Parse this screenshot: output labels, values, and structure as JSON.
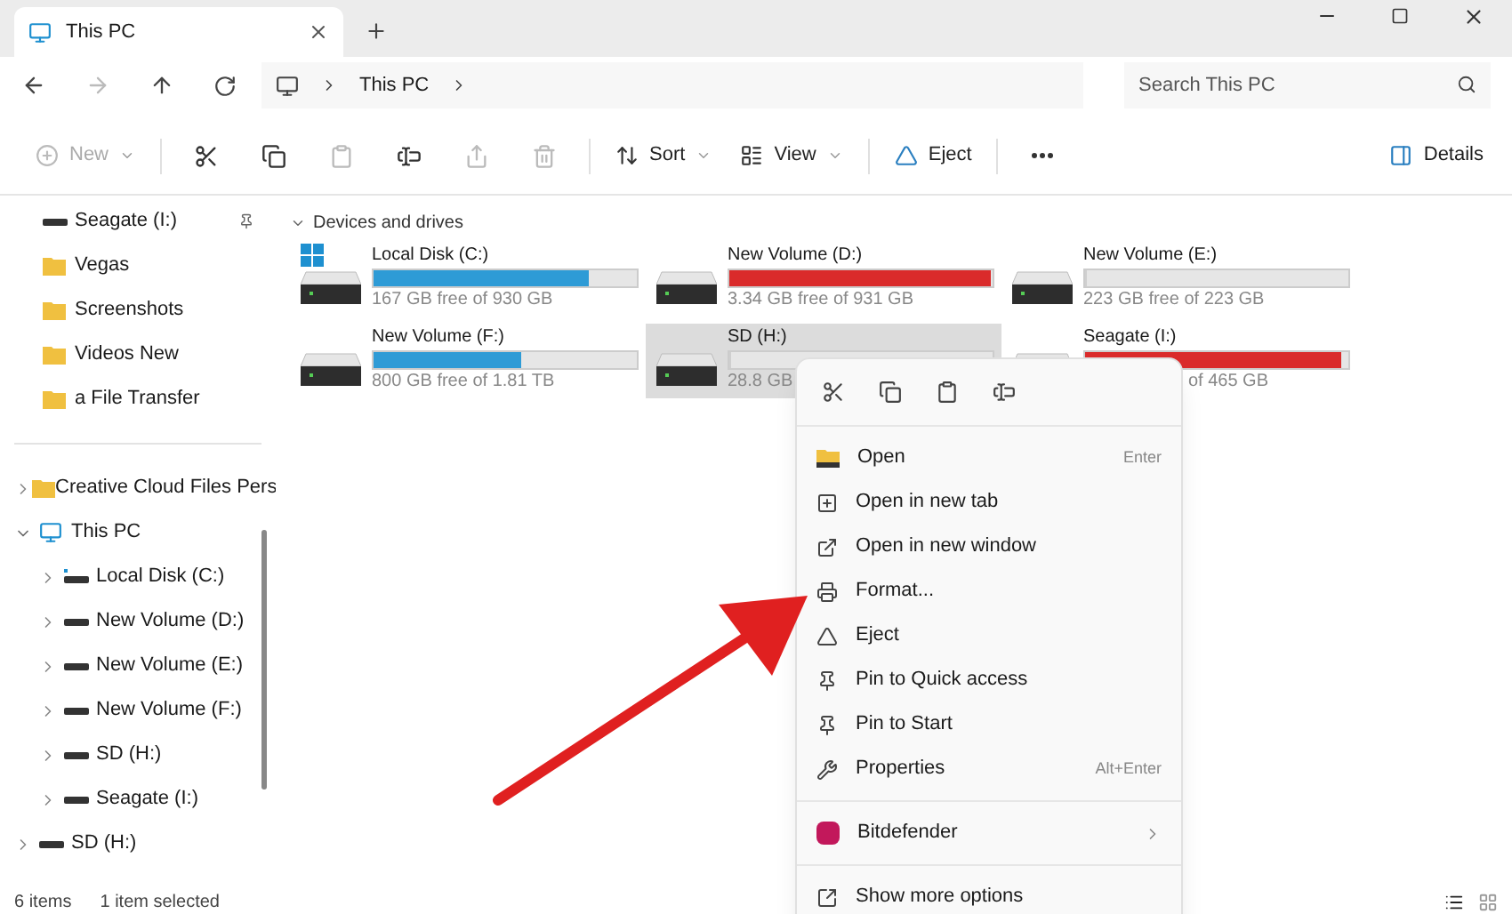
{
  "tabs": [
    {
      "label": "This PC",
      "selected": true
    }
  ],
  "address": {
    "path": [
      "This PC"
    ]
  },
  "search": {
    "placeholder": "Search This PC"
  },
  "toolbar": [
    {
      "kind": "menu",
      "label": "New",
      "disabled": true
    },
    {
      "kind": "icon",
      "disabled": false
    },
    {
      "kind": "icon",
      "disabled": false
    },
    {
      "kind": "icon",
      "disabled": true
    },
    {
      "kind": "icon",
      "disabled": false
    },
    {
      "kind": "icon",
      "disabled": true
    },
    {
      "kind": "icon",
      "disabled": true
    },
    {
      "kind": "menu",
      "label": "Sort",
      "disabled": false
    },
    {
      "kind": "menu",
      "label": "View",
      "disabled": false
    },
    {
      "kind": "button",
      "label": "Eject",
      "disabled": false
    },
    {
      "kind": "more",
      "disabled": false
    }
  ],
  "details_button": {
    "label": "Details"
  },
  "sidebar": {
    "pinned": [
      {
        "label": "Seagate (I:)",
        "kind": "drive",
        "pinned": true
      },
      {
        "label": "Vegas",
        "kind": "folder",
        "pinned": false
      },
      {
        "label": "Screenshots",
        "kind": "folder",
        "pinned": false
      },
      {
        "label": "Videos New",
        "kind": "folder",
        "pinned": false
      },
      {
        "label": "a File Transfer",
        "kind": "folder",
        "pinned": false
      }
    ],
    "tree": [
      {
        "label": "Creative Cloud Files Pers",
        "kind": "folder",
        "expanded": false
      },
      {
        "label": "This PC",
        "kind": "pc",
        "expanded": true,
        "children": [
          {
            "label": "Local Disk (C:)",
            "kind": "system",
            "expanded": false
          },
          {
            "label": "New Volume (D:)",
            "kind": "drive",
            "expanded": false
          },
          {
            "label": "New Volume (E:)",
            "kind": "drive",
            "expanded": false
          },
          {
            "label": "New Volume (F:)",
            "kind": "drive",
            "expanded": false
          },
          {
            "label": "SD (H:)",
            "kind": "drive",
            "expanded": false
          },
          {
            "label": "Seagate (I:)",
            "kind": "drive",
            "expanded": false
          }
        ]
      },
      {
        "label": "SD (H:)",
        "kind": "drive",
        "expanded": false
      }
    ]
  },
  "section": {
    "title": "Devices and drives",
    "expanded": true
  },
  "drives": [
    {
      "name": "Local Disk (C:)",
      "free": "167 GB free of 930 GB",
      "level": 0.82,
      "color": "#2e9bd6",
      "system": true,
      "selected": false,
      "hidden_start": false
    },
    {
      "name": "New Volume (D:)",
      "free": "3.34 GB free of 931 GB",
      "level": 0.99,
      "color": "#da2b2b",
      "system": false,
      "selected": false,
      "hidden_start": false
    },
    {
      "name": "New Volume (E:)",
      "free": "223 GB free of 223 GB",
      "level": 0.0,
      "system": false,
      "selected": false,
      "hidden_start": false
    },
    {
      "name": "New Volume (F:)",
      "free": "800 GB free of 1.81 TB",
      "level": 0.56,
      "color": "#2e9bd6",
      "system": false,
      "selected": false,
      "hidden_start": false
    },
    {
      "name": "SD (H:)",
      "free": "28.8 GB",
      "level": 0.0,
      "system": false,
      "selected": true,
      "hidden_start": false
    },
    {
      "name": "Seagate (I:)",
      "free": "of 465 GB",
      "level": 0.97,
      "color": "#da2b2b",
      "system": false,
      "selected": false,
      "hidden_start": true
    }
  ],
  "status_bar": {
    "items": "6 items",
    "selected": "1 item selected"
  },
  "context_menu": {
    "sections": [
      [
        {
          "label": "Open",
          "shortcut": "Enter",
          "submenu": false
        },
        {
          "label": "Open in new tab",
          "submenu": false
        },
        {
          "label": "Open in new window",
          "submenu": false
        },
        {
          "label": "Format...",
          "submenu": false
        },
        {
          "label": "Eject",
          "submenu": false
        },
        {
          "label": "Pin to Quick access",
          "submenu": false
        },
        {
          "label": "Pin to Start",
          "submenu": false
        },
        {
          "label": "Properties",
          "shortcut": "Alt+Enter",
          "submenu": false
        }
      ],
      [
        {
          "label": "Bitdefender",
          "submenu": true
        }
      ],
      [
        {
          "label": "Show more options",
          "submenu": false
        }
      ]
    ]
  },
  "annotation": {
    "kind": "arrow",
    "color": "#e02020"
  }
}
